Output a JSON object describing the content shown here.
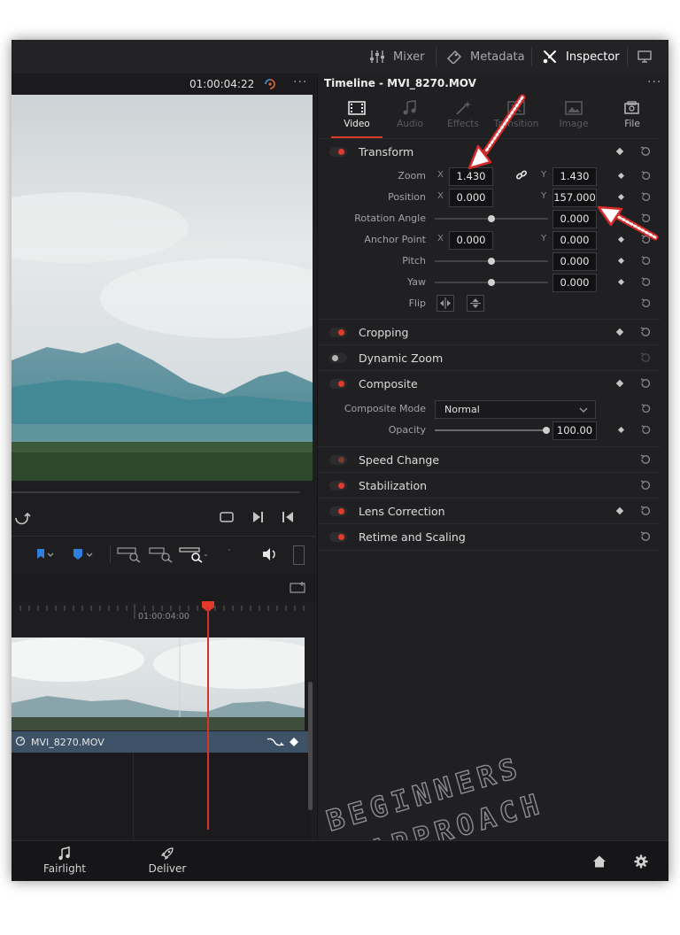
{
  "topbar": {
    "mixer_label": "Mixer",
    "metadata_label": "Metadata",
    "inspector_label": "Inspector"
  },
  "viewer": {
    "timecode": "01:00:04:22"
  },
  "timeline": {
    "ruler_timecode": "01:00:04:00",
    "clip_name": "MVI_8270.MOV"
  },
  "inspector": {
    "title": "Timeline - MVI_8270.MOV",
    "tabs": [
      {
        "label": "Video",
        "icon": "video-icon",
        "active": true
      },
      {
        "label": "Audio",
        "icon": "audio-icon",
        "active": false
      },
      {
        "label": "Effects",
        "icon": "effects-icon",
        "active": false
      },
      {
        "label": "Transition",
        "icon": "transition-icon",
        "active": false
      },
      {
        "label": "Image",
        "icon": "image-icon",
        "active": false
      },
      {
        "label": "File",
        "icon": "file-icon",
        "active": false
      }
    ],
    "transform": {
      "title": "Transform",
      "zoom_label": "Zoom",
      "zoom_x": "1.430",
      "zoom_y": "1.430",
      "position_label": "Position",
      "position_x": "0.000",
      "position_y": "157.000",
      "rotation_label": "Rotation Angle",
      "rotation": "0.000",
      "anchor_label": "Anchor Point",
      "anchor_x": "0.000",
      "anchor_y": "0.000",
      "pitch_label": "Pitch",
      "pitch": "0.000",
      "yaw_label": "Yaw",
      "yaw": "0.000",
      "flip_label": "Flip",
      "axis_x": "X",
      "axis_y": "Y"
    },
    "cropping": {
      "title": "Cropping"
    },
    "dynamic_zoom": {
      "title": "Dynamic Zoom"
    },
    "composite": {
      "title": "Composite",
      "mode_label": "Composite Mode",
      "mode_value": "Normal",
      "opacity_label": "Opacity",
      "opacity": "100.00"
    },
    "speed_change": {
      "title": "Speed Change"
    },
    "stabilization": {
      "title": "Stabilization"
    },
    "lens_correction": {
      "title": "Lens Correction"
    },
    "retime": {
      "title": "Retime and Scaling"
    }
  },
  "bottombar": {
    "fairlight_label": "Fairlight",
    "deliver_label": "Deliver"
  },
  "watermark": {
    "line1": "BEGINNERS",
    "line2": "APPROACH"
  },
  "colors": {
    "accent_red": "#e23b2b",
    "panel_bg": "#202022",
    "clip_blue": "#3d5266"
  }
}
